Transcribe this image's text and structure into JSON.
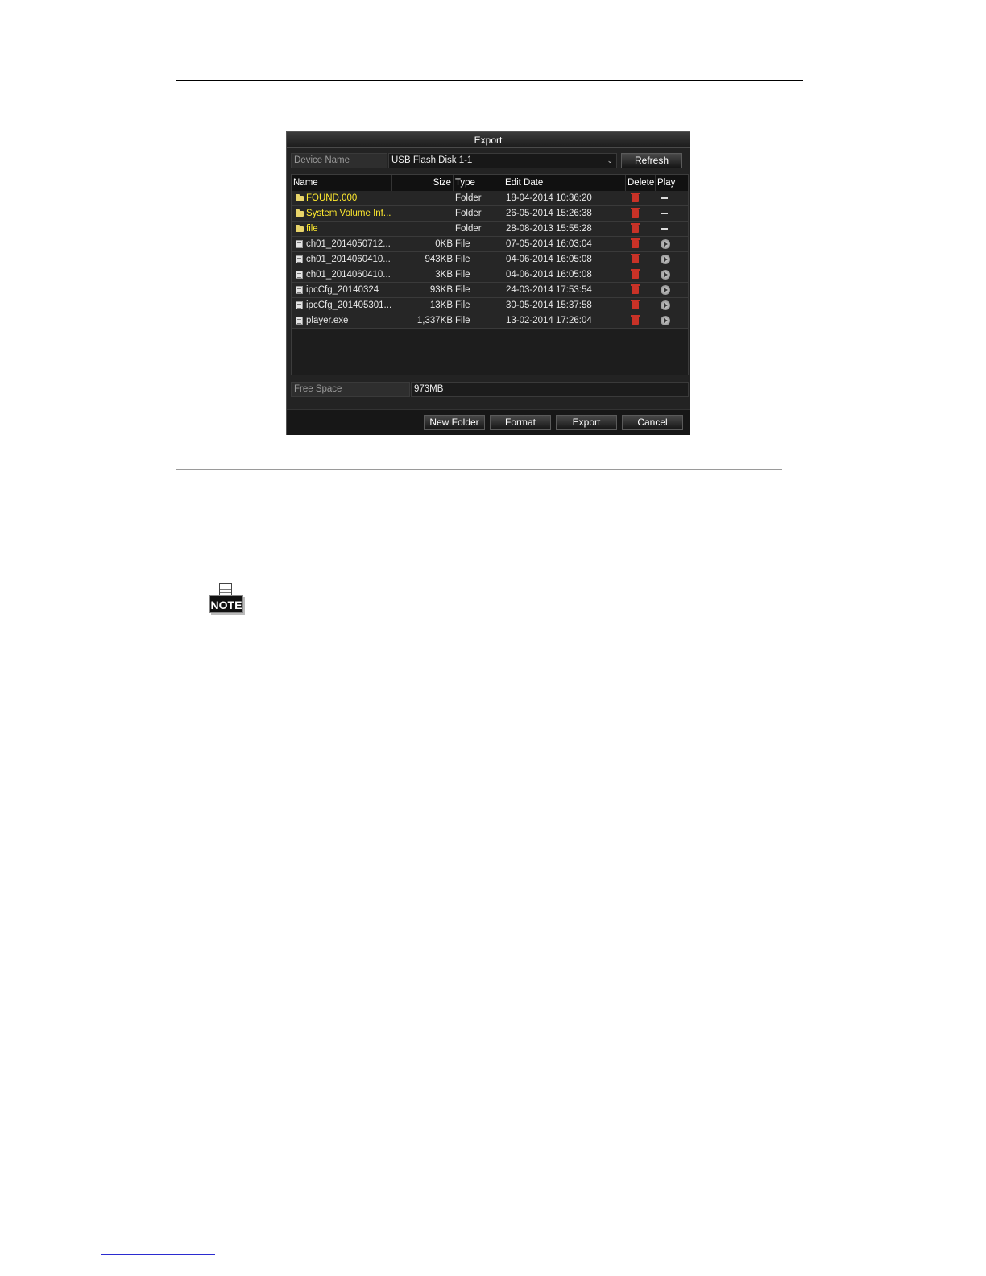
{
  "dialog": {
    "title": "Export",
    "device_name_label": "Device Name",
    "device_name_value": "USB Flash Disk 1-1",
    "refresh_label": "Refresh",
    "columns": {
      "name": "Name",
      "size": "Size",
      "type": "Type",
      "edit_date": "Edit Date",
      "delete": "Delete",
      "play": "Play"
    },
    "rows": [
      {
        "name": "FOUND.000",
        "size": "",
        "type": "Folder",
        "date": "18-04-2014 10:36:20"
      },
      {
        "name": "System Volume Inf...",
        "size": "",
        "type": "Folder",
        "date": "26-05-2014 15:26:38"
      },
      {
        "name": "file",
        "size": "",
        "type": "Folder",
        "date": "28-08-2013 15:55:28"
      },
      {
        "name": "ch01_2014050712...",
        "size": "0KB",
        "type": "File",
        "date": "07-05-2014 16:03:04"
      },
      {
        "name": "ch01_2014060410...",
        "size": "943KB",
        "type": "File",
        "date": "04-06-2014 16:05:08"
      },
      {
        "name": "ch01_2014060410...",
        "size": "3KB",
        "type": "File",
        "date": "04-06-2014 16:05:08"
      },
      {
        "name": "ipcCfg_20140324",
        "size": "93KB",
        "type": "File",
        "date": "24-03-2014 17:53:54"
      },
      {
        "name": "ipcCfg_201405301...",
        "size": "13KB",
        "type": "File",
        "date": "30-05-2014 15:37:58"
      },
      {
        "name": "player.exe",
        "size": "1,337KB",
        "type": "File",
        "date": "13-02-2014 17:26:04"
      }
    ],
    "free_space_label": "Free Space",
    "free_space_value": "973MB",
    "buttons": {
      "new_folder": "New Folder",
      "format": "Format",
      "export": "Export",
      "cancel": "Cancel"
    }
  },
  "note_badge": "NOTE",
  "colors": {
    "folder_text": "#ffea2e",
    "delete_icon": "#c83227"
  }
}
